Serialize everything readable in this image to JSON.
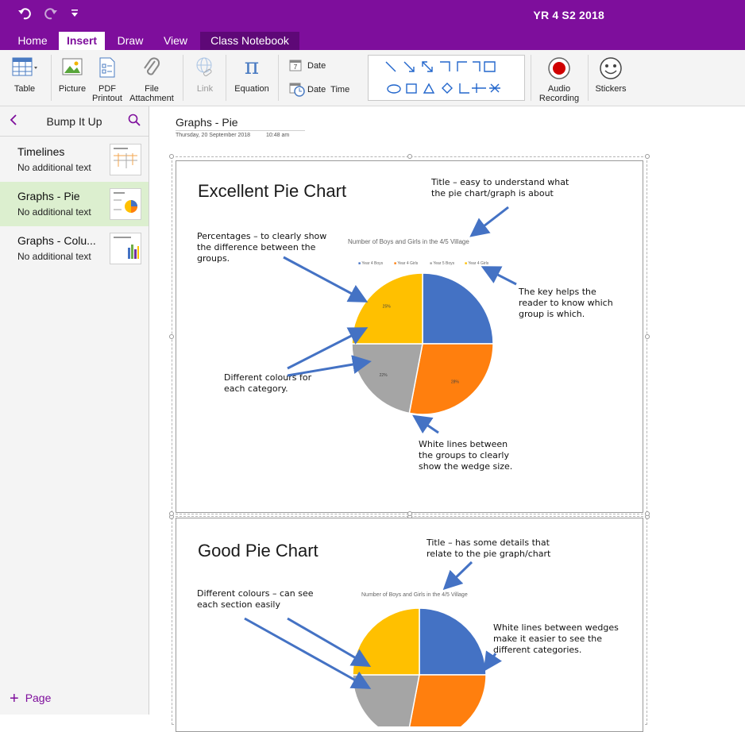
{
  "window": {
    "title": "YR 4 S2 2018",
    "quick_access": {
      "undo_icon": "undo-icon",
      "redo_icon": "redo-icon",
      "customize_icon": "customize-icon"
    }
  },
  "ribbon_tabs": [
    {
      "label": "Home"
    },
    {
      "label": "Insert",
      "active": true
    },
    {
      "label": "Draw"
    },
    {
      "label": "View"
    },
    {
      "label": "Class Notebook"
    }
  ],
  "ribbon": {
    "table": "Table",
    "picture": "Picture",
    "pdf_printout_1": "PDF",
    "pdf_printout_2": "Printout",
    "file_attachment_1": "File",
    "file_attachment_2": "Attachment",
    "link": "Link",
    "equation": "Equation",
    "date": "Date",
    "date_time": "Date  Time",
    "audio_recording_1": "Audio",
    "audio_recording_2": "Recording",
    "stickers": "Stickers"
  },
  "sidebar": {
    "section_title": "Bump It Up",
    "pages": [
      {
        "name": "Timelines",
        "preview": "No additional text"
      },
      {
        "name": "Graphs - Pie",
        "preview": "No additional text",
        "selected": true
      },
      {
        "name": "Graphs - Colu...",
        "preview": "No additional text"
      }
    ],
    "add_page": "Page"
  },
  "page": {
    "title": "Graphs - Pie",
    "date": "Thursday, 20 September 2018",
    "time": "10:48 am"
  },
  "slides": [
    {
      "heading": "Excellent Pie Chart",
      "notes": {
        "title_note_1": "Title – easy to understand what",
        "title_note_2": "the pie chart/graph is about",
        "pct_note_1": "Percentages – to clearly show",
        "pct_note_2": "the difference between the",
        "pct_note_3": "groups.",
        "key_note_1": "The key helps the",
        "key_note_2": "reader to know which",
        "key_note_3": "group is which.",
        "colour_note_1": "Different colours for",
        "colour_note_2": "each category.",
        "white_note_1": "White lines between",
        "white_note_2": "the groups to clearly",
        "white_note_3": "show the wedge size."
      }
    },
    {
      "heading": "Good Pie Chart",
      "notes": {
        "title_note_1": "Title – has some details that",
        "title_note_2": "relate to the pie graph/chart",
        "colour_note_1": "Different colours – can see",
        "colour_note_2": "each section easily",
        "white_note_1": "White lines between wedges",
        "white_note_2": "make it easier to see the",
        "white_note_3": "different categories."
      }
    }
  ],
  "chart_data": [
    {
      "type": "pie",
      "title": "Number of Boys and Girls in the 4/5 Village",
      "categories": [
        "Year 4 Boys",
        "Year 4 Girls",
        "Year 5 Boys",
        "Year 4 Girls"
      ],
      "values": [
        25,
        28,
        22,
        25
      ],
      "labels": [
        "",
        "28%",
        "22%",
        "25%"
      ],
      "colors": [
        "#4472c4",
        "#ff7f0e",
        "#a5a5a5",
        "#ffc000"
      ],
      "legend": "top"
    },
    {
      "type": "pie",
      "title": "Number of Boys and Girls in the 4/5 Village",
      "values": [
        25,
        28,
        22,
        25
      ],
      "colors": [
        "#4472c4",
        "#ff7f0e",
        "#a5a5a5",
        "#ffc000"
      ]
    }
  ],
  "colors": {
    "brand": "#7e0e9c",
    "selected_page": "#dcefcf",
    "arrow": "#4472c4"
  }
}
